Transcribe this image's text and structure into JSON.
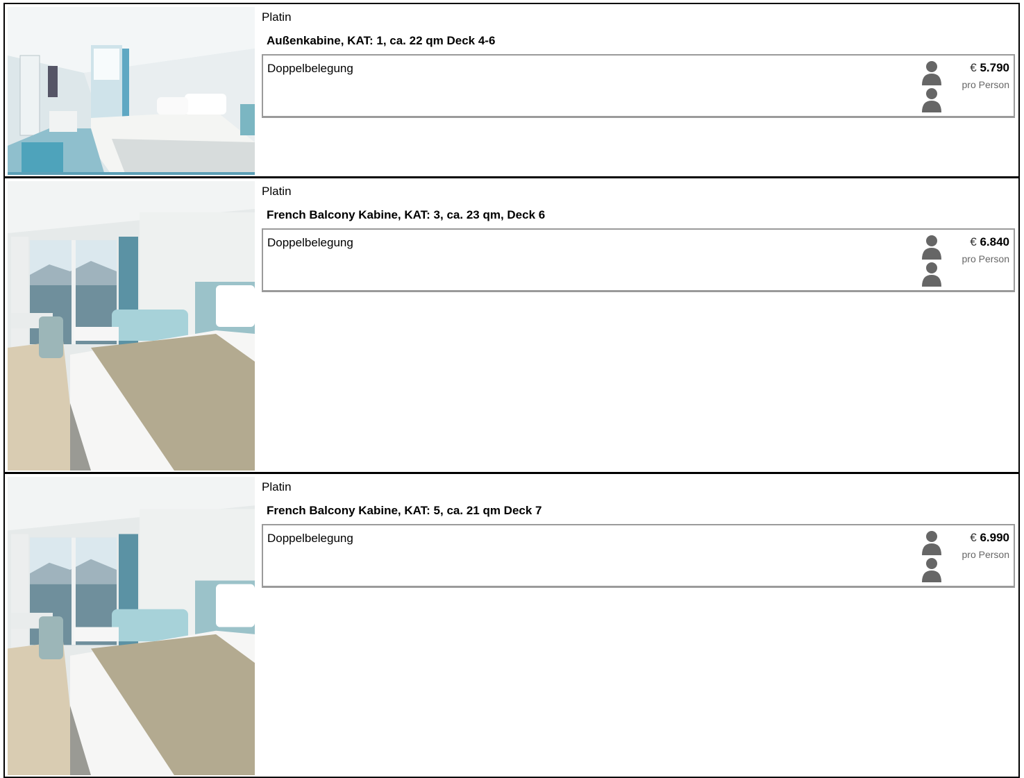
{
  "cabins": [
    {
      "tier": "Platin",
      "title": "Außenkabine, KAT: 1, ca. 22 qm Deck 4-6",
      "occupancy": "Doppelbelegung",
      "currency": "€",
      "price": "5.790",
      "per_person": "pro Person",
      "image_icon": "cabin-photo-bedroom"
    },
    {
      "tier": "Platin",
      "title": "French Balcony Kabine, KAT: 3, ca. 23 qm, Deck 6",
      "occupancy": "Doppelbelegung",
      "currency": "€",
      "price": "6.840",
      "per_person": "pro Person",
      "image_icon": "cabin-photo-balcony"
    },
    {
      "tier": "Platin",
      "title": "French Balcony Kabine, KAT: 5, ca. 21 qm Deck 7",
      "occupancy": "Doppelbelegung",
      "currency": "€",
      "price": "6.990",
      "per_person": "pro Person",
      "image_icon": "cabin-photo-balcony"
    }
  ],
  "colors": {
    "border": "#000000",
    "occupancy_border": "#9a9a9a",
    "person_icon": "#666666",
    "teal_accent": "#6fb3c1"
  }
}
